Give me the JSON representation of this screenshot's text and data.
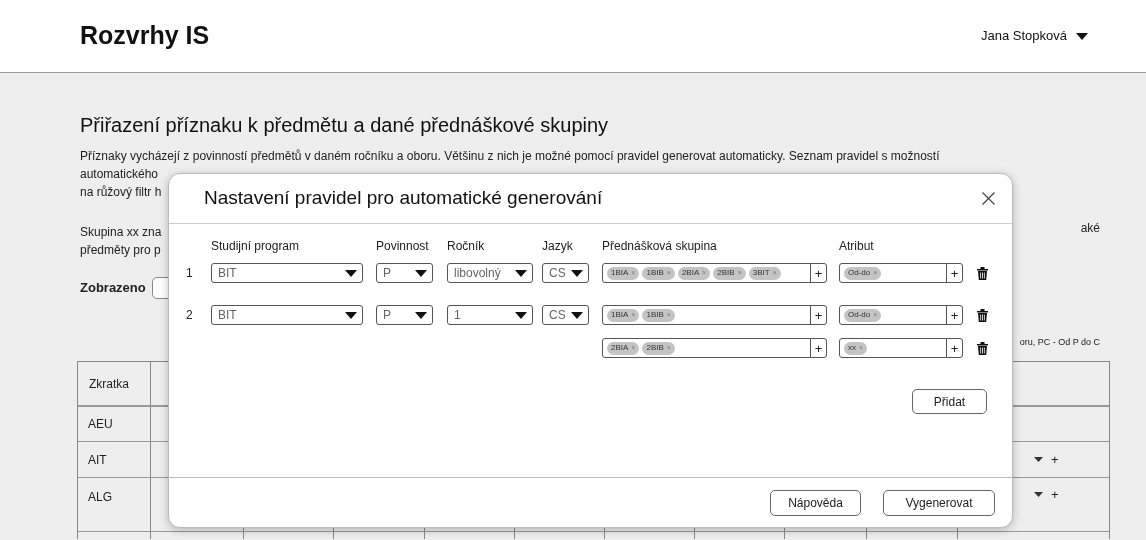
{
  "header": {
    "app_title": "Rozvrhy IS",
    "user": "Jana Stopková"
  },
  "page": {
    "title": "Přiřazení příznaku k předmětu a dané přednáškové skupiny",
    "intro_lines": [
      "Příznaky vycházejí z povinností předmětů v daném ročníku a oboru. Většinu z nich je možné pomocí pravidel generovat automaticky. Seznam pravidel s možností",
      "automatického",
      "na růžový filtr h"
    ],
    "group_line_left": "Skupina xx zna",
    "group_line_right": "aké",
    "group_line_2": "předměty pro p",
    "shown_label": "Zobrazeno",
    "legend_fragment": "oru, PC - Od P do C"
  },
  "table": {
    "columns": [
      {
        "label": "Zkratka"
      }
    ],
    "rows": [
      {
        "code": "AEU",
        "actions": false
      },
      {
        "code": "AIT",
        "actions": true
      },
      {
        "code": "ALG",
        "actions": true
      }
    ],
    "add_glyph": "+"
  },
  "dialog": {
    "title": "Nastavení pravidel pro automatické generování",
    "columns": [
      "Studijní program",
      "Povinnost",
      "Ročník",
      "Jazyk",
      "Přednášková skupina",
      "Atribut"
    ],
    "tag_remove_glyph": "×",
    "add_glyph": "+",
    "rules": [
      {
        "number": "1",
        "program": "BIT",
        "obligation": "P",
        "year": "libovolný",
        "language": "CS",
        "groups": [
          {
            "lecture_groups": [
              "1BIA",
              "1BIB",
              "2BIA",
              "2BIB",
              "3BIT"
            ],
            "attributes": [
              "Od-do"
            ]
          }
        ]
      },
      {
        "number": "2",
        "program": "BIT",
        "obligation": "P",
        "year": "1",
        "language": "CS",
        "groups": [
          {
            "lecture_groups": [
              "1BIA",
              "1BIB"
            ],
            "attributes": [
              "Od-do"
            ]
          },
          {
            "lecture_groups": [
              "2BIA",
              "2BIB"
            ],
            "attributes": [
              "xx"
            ]
          }
        ]
      }
    ],
    "add_button": "Přidat",
    "help_button": "Nápověda",
    "generate_button": "Vygenerovat"
  }
}
